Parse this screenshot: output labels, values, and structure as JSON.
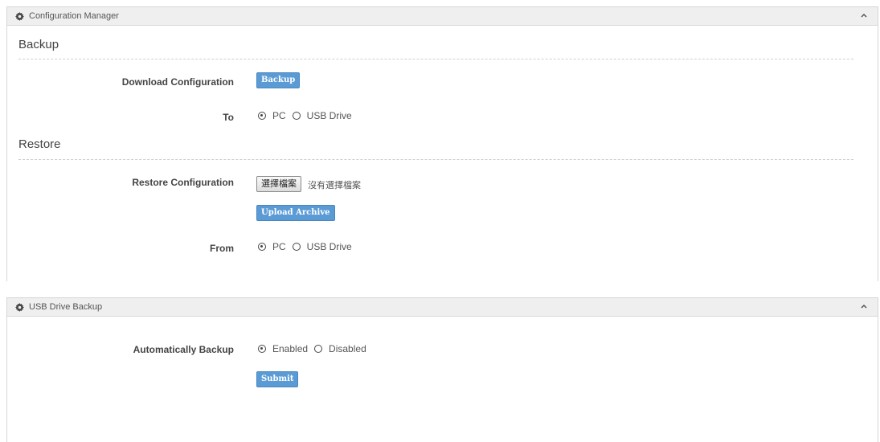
{
  "config_panel": {
    "title": "Configuration Manager",
    "backup": {
      "title": "Backup",
      "download_label": "Download Configuration",
      "backup_button": "Backup",
      "to_label": "To",
      "options": [
        "PC",
        "USB Drive"
      ],
      "selected": "PC"
    },
    "restore": {
      "title": "Restore",
      "restore_label": "Restore Configuration",
      "choose_file_button": "選擇檔案",
      "file_status": "沒有選擇檔案",
      "upload_button": "Upload Archive",
      "from_label": "From",
      "options": [
        "PC",
        "USB Drive"
      ],
      "selected": "PC"
    }
  },
  "usb_panel": {
    "title": "USB Drive Backup",
    "auto_label": "Automatically Backup",
    "options": [
      "Enabled",
      "Disabled"
    ],
    "selected": "Enabled",
    "submit_button": "Submit"
  },
  "colors": {
    "button": "#5b9bd5",
    "header_bg": "#efefef"
  },
  "icons": [
    "gear-icon",
    "chevron-up-icon"
  ]
}
